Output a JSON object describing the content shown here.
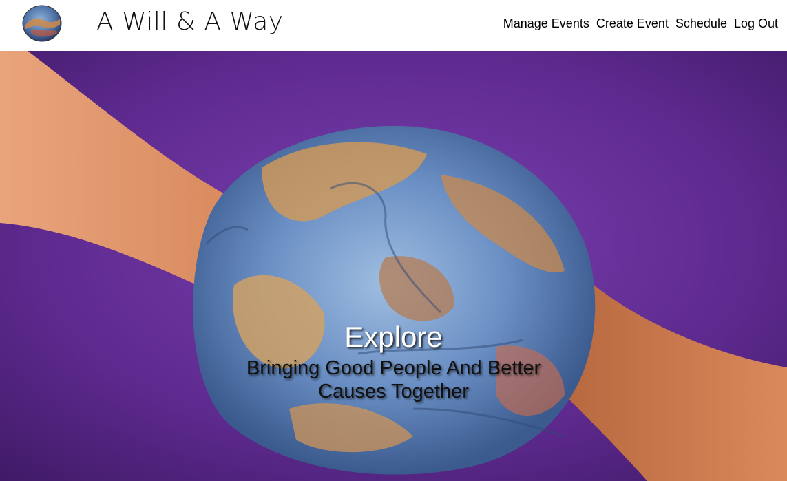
{
  "brand": {
    "title": "A Will & A Way",
    "logo_icon": "globe-hands-icon"
  },
  "nav": {
    "items": [
      {
        "label": "Manage Events"
      },
      {
        "label": "Create Event"
      },
      {
        "label": "Schedule"
      },
      {
        "label": "Log Out"
      }
    ]
  },
  "hero": {
    "title": "Explore",
    "subtitle": "Bringing Good People And Better Causes Together",
    "background_color": "#5e2a8f",
    "image_icon": "globe-painted-hands-illustration"
  }
}
